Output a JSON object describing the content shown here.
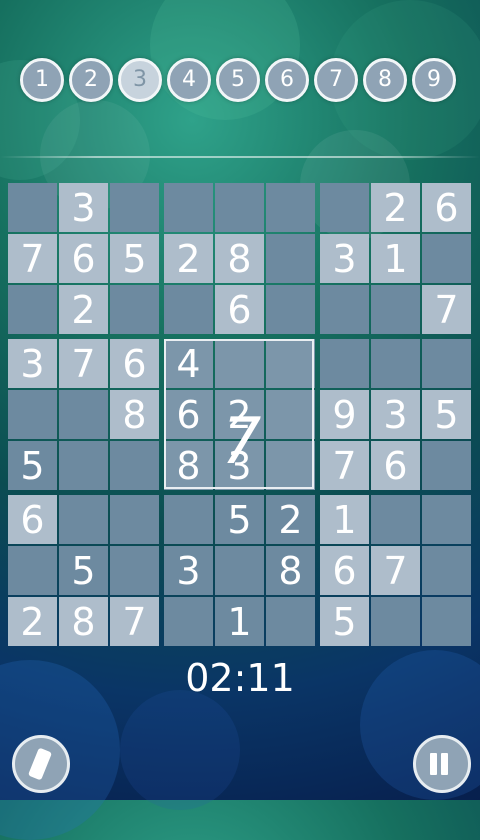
{
  "number_selector": {
    "selected": "3",
    "items": [
      "1",
      "2",
      "3",
      "4",
      "5",
      "6",
      "7",
      "8",
      "9"
    ]
  },
  "board": {
    "rows": [
      [
        "",
        "3",
        "",
        "",
        "",
        "",
        "",
        "2",
        "6"
      ],
      [
        "7",
        "6",
        "5",
        "2",
        "8",
        "",
        "3",
        "1",
        ""
      ],
      [
        "",
        "2",
        "",
        "",
        "6",
        "",
        "",
        "",
        "7"
      ],
      [
        "3",
        "7",
        "6",
        "4",
        "",
        "",
        "",
        "",
        ""
      ],
      [
        "",
        "",
        "8",
        "6",
        "2",
        "",
        "9",
        "3",
        "5"
      ],
      [
        "5",
        "",
        "",
        "8",
        "3",
        "",
        "7",
        "6",
        ""
      ],
      [
        "6",
        "",
        "",
        "",
        "5",
        "2",
        "1",
        "",
        ""
      ],
      [
        "",
        "5",
        "",
        "3",
        "",
        "8",
        "6",
        "7",
        ""
      ],
      [
        "2",
        "8",
        "7",
        "",
        "1",
        "",
        "5",
        "",
        ""
      ]
    ],
    "given": [
      [
        false,
        true,
        false,
        false,
        false,
        false,
        false,
        true,
        true
      ],
      [
        true,
        true,
        true,
        true,
        true,
        false,
        true,
        true,
        false
      ],
      [
        false,
        true,
        false,
        false,
        true,
        false,
        false,
        false,
        true
      ],
      [
        true,
        true,
        true,
        false,
        false,
        false,
        false,
        false,
        false
      ],
      [
        false,
        false,
        true,
        false,
        false,
        false,
        true,
        true,
        true
      ],
      [
        false,
        false,
        false,
        false,
        false,
        false,
        true,
        true,
        false
      ],
      [
        true,
        false,
        false,
        false,
        false,
        false,
        true,
        false,
        false
      ],
      [
        false,
        false,
        false,
        false,
        false,
        false,
        true,
        true,
        false
      ],
      [
        true,
        true,
        true,
        false,
        false,
        false,
        true,
        false,
        false
      ]
    ],
    "highlighted_box": "center",
    "cursor_glyph": "7"
  },
  "timer": "02:11",
  "controls": {
    "pencil_icon": "pencil-icon",
    "pause_icon": "pause-icon"
  },
  "colors": {
    "cell": "#6d8aa0",
    "given_cell": "#aebdcb",
    "button": "#8fa3b5"
  }
}
